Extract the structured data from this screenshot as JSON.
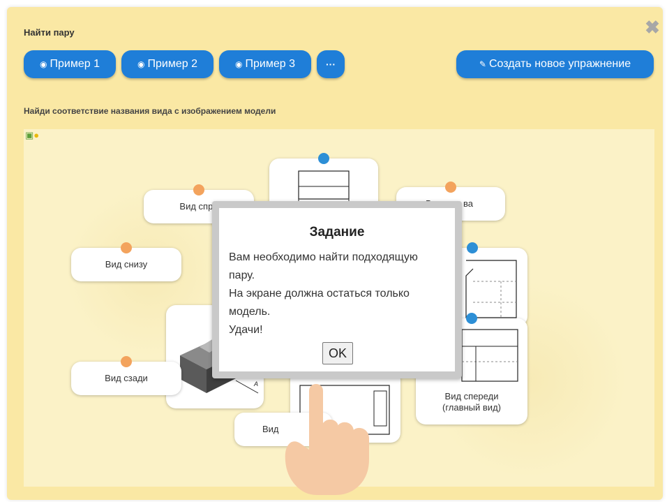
{
  "header": {
    "title": "Найти пару",
    "close_glyph": "✖"
  },
  "toolbar": {
    "example_buttons": [
      {
        "label": "Пример 1",
        "icon": "eye-icon"
      },
      {
        "label": "Пример 2",
        "icon": "eye-icon"
      },
      {
        "label": "Пример 3",
        "icon": "eye-icon"
      }
    ],
    "more_label": "···",
    "create_label": "Создать новое упражнение",
    "create_icon": "pencil-icon",
    "button_color": "#1f7ed8"
  },
  "exercise": {
    "instruction": "Найди соответствие названия вида с изображением модели",
    "helper_icons": [
      "hint-icon",
      "lightbulb-icon"
    ],
    "label_cards": [
      {
        "text": "Вид спра",
        "dot": "orange"
      },
      {
        "text": "Вид снизу",
        "dot": "orange"
      },
      {
        "text": "Вид сзади",
        "dot": "orange"
      },
      {
        "text": "В",
        "dot": "orange"
      },
      {
        "text": "ва",
        "dot": "orange"
      },
      {
        "text": "Вид",
        "dot": "orange"
      },
      {
        "text_line1": "Вид спереди",
        "text_line2": "(главный вид)",
        "dot": "blue"
      }
    ],
    "model_label": "A",
    "dot_colors": {
      "orange": "#f3a35d",
      "blue": "#2d8fd6"
    }
  },
  "dialog": {
    "title": "Задание",
    "lines": [
      "Вам необходимо найти подходящую",
      "пару.",
      "На экране должна остаться только",
      "модель.",
      "Удачи!"
    ],
    "ok_label": "OK"
  },
  "colors": {
    "panel_background": "#fae8a4",
    "board_background": "#fbf2c7"
  }
}
